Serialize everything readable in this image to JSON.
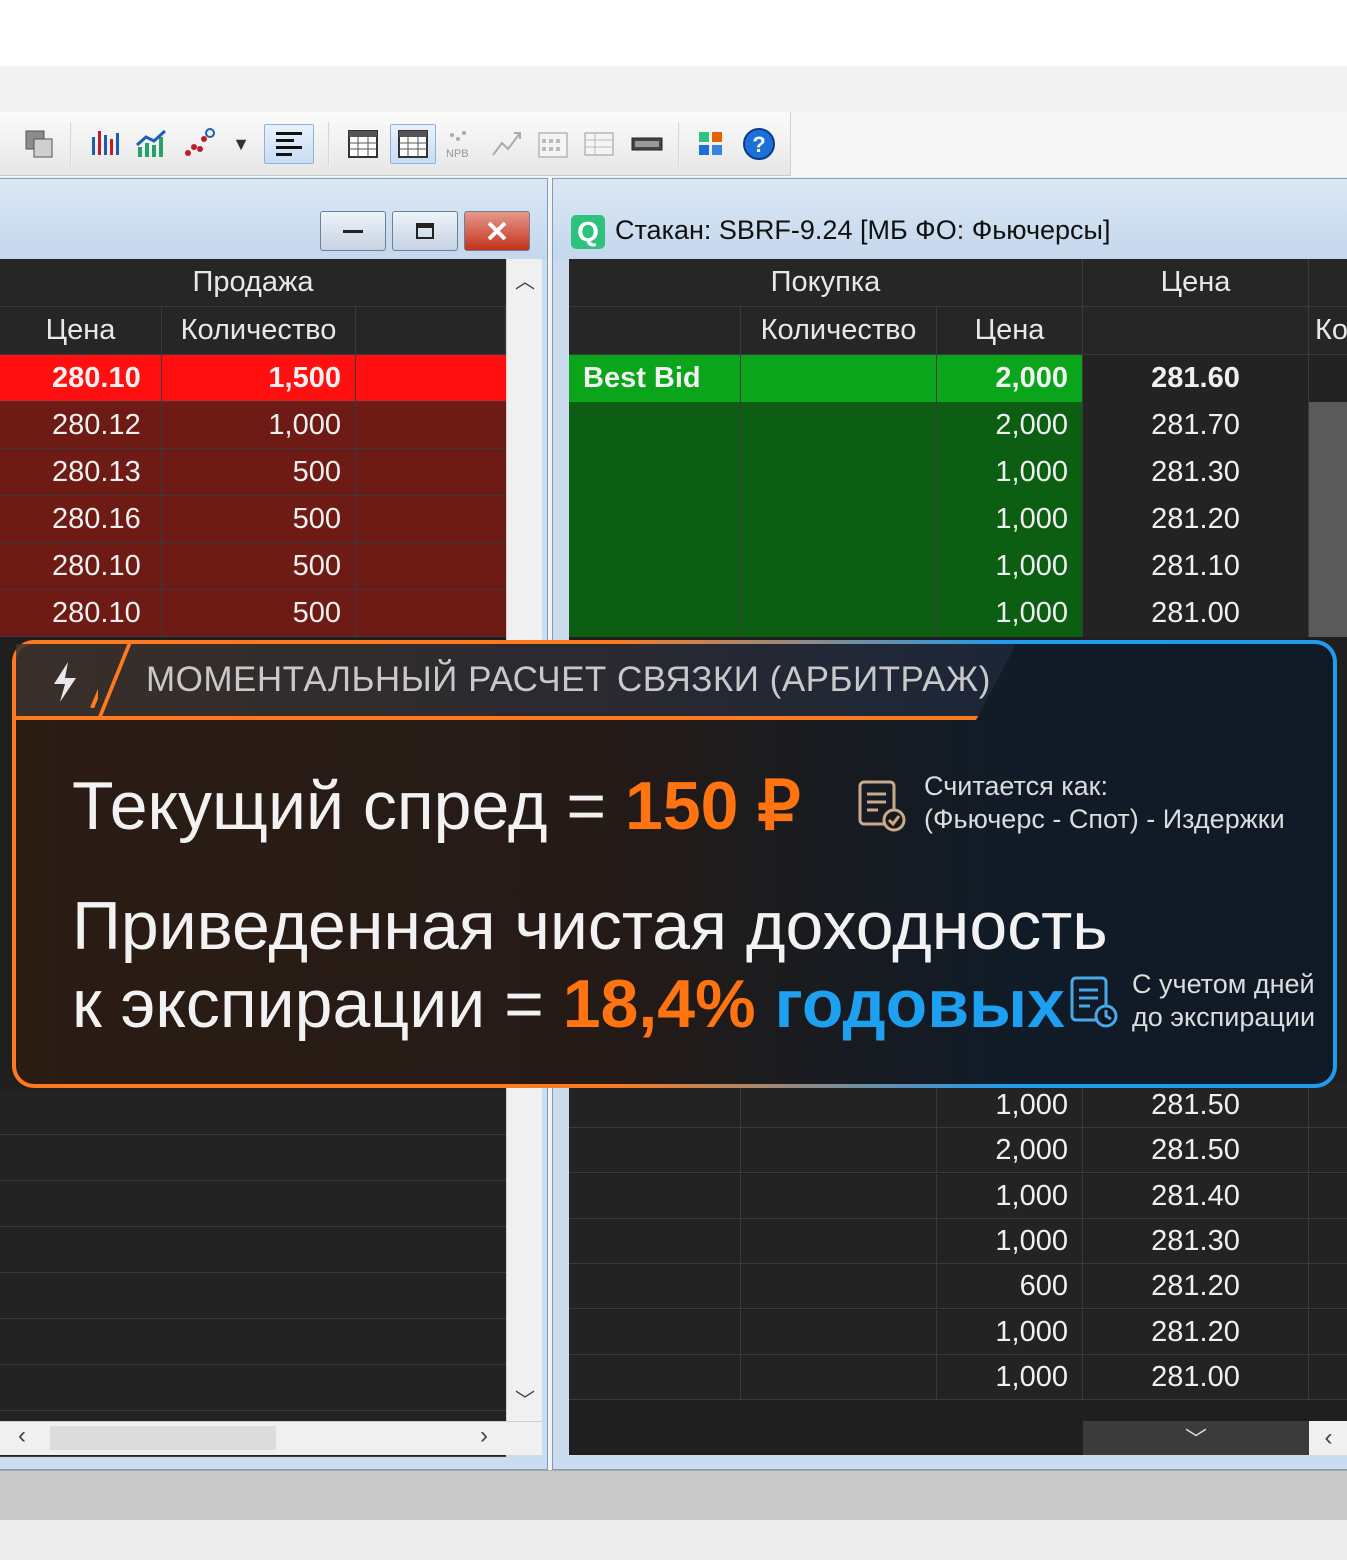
{
  "toolbar": {
    "icons": [
      "copy-icon",
      "bar-chart-icon",
      "line-chart-icon",
      "scatter-chart-icon",
      "dropdown-arrow-icon",
      "align-left-icon",
      "table-icon",
      "table-active-icon",
      "npb-icon",
      "chart-arrow-icon",
      "calendar-icon",
      "grid-icon",
      "ticker-icon",
      "palette-icon",
      "help-icon"
    ],
    "help_label": "?"
  },
  "left_window": {
    "header_group": "Продажа",
    "columns": [
      "Цена",
      "Количество"
    ],
    "rows": [
      {
        "price": "280.10",
        "qty": "1,500",
        "best": true
      },
      {
        "price": "280.12",
        "qty": "1,000"
      },
      {
        "price": "280.13",
        "qty": "500"
      },
      {
        "price": "280.16",
        "qty": "500"
      },
      {
        "price": "280.10",
        "qty": "500"
      },
      {
        "price": "280.10",
        "qty": "500"
      }
    ]
  },
  "right_window": {
    "title": "Стакан: SBRF-9.24 [МБ ФО: Фьючерсы]",
    "app_icon": "Q",
    "header_group_buy": "Покупка",
    "header_price": "Цена",
    "header_partial": "Ко",
    "columns": [
      "Количество",
      "Цена"
    ],
    "best_bid_label": "Best Bid",
    "top_rows": [
      {
        "qty": "2,000",
        "price": "281.60"
      },
      {
        "qty": "2,000",
        "price": "281.70"
      },
      {
        "qty": "1,000",
        "price": "281.30"
      },
      {
        "qty": "1,000",
        "price": "281.20"
      },
      {
        "qty": "1,000",
        "price": "281.10"
      },
      {
        "qty": "1,000",
        "price": "281.00"
      }
    ],
    "bottom_rows": [
      {
        "qty": "1,000",
        "price": "281.50"
      },
      {
        "qty": "2,000",
        "price": "281.50"
      },
      {
        "qty": "1,000",
        "price": "281.40"
      },
      {
        "qty": "1,000",
        "price": "281.30"
      },
      {
        "qty": "600",
        "price": "281.20"
      },
      {
        "qty": "1,000",
        "price": "281.20"
      },
      {
        "qty": "1,000",
        "price": "281.00"
      }
    ]
  },
  "overlay": {
    "title": "МОМЕНТАЛЬНЫЙ РАСЧЕТ СВЯЗКИ (АРБИТРАЖ)",
    "spread_label": "Текущий спред = ",
    "spread_value": "150 ₽",
    "spread_note_1": "Считается как:",
    "spread_note_2": "(Фьючерс - Спот) - Издержки",
    "yield_line1": "Приведенная чистая доходность",
    "yield_line2": "к экспирации = ",
    "yield_value": "18,4%",
    "yield_unit": "годовых",
    "yield_note_1": "С учетом дней",
    "yield_note_2": "до экспирации",
    "accent_orange": "#ff7411",
    "accent_blue": "#1ea0f2"
  }
}
